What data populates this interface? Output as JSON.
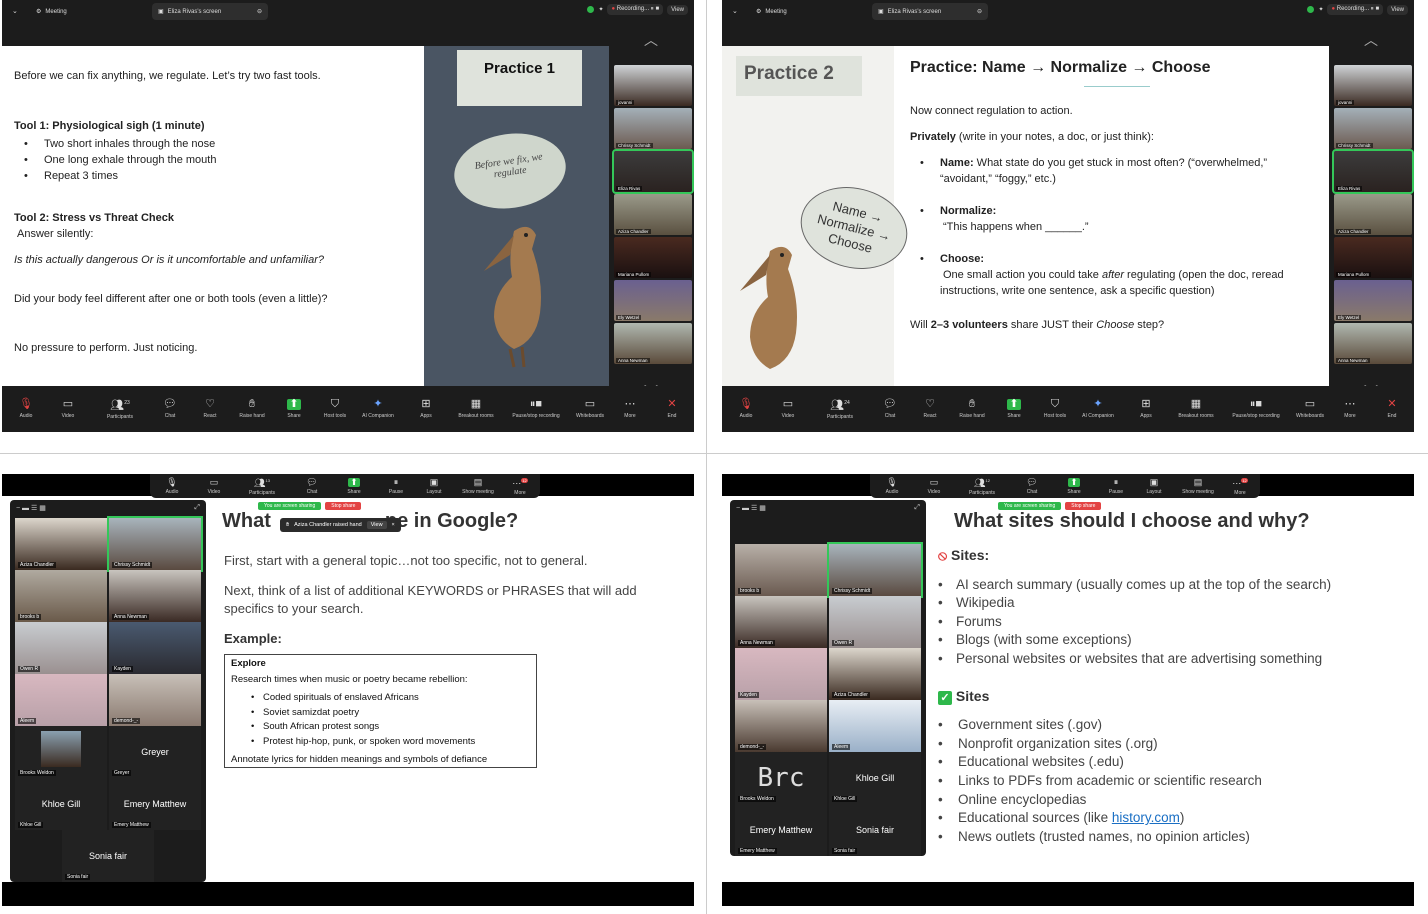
{
  "colors": {
    "zoom_green": "#2eb84b",
    "zoom_red": "#e34343",
    "link_blue": "#1a6fc4",
    "slide_gray": "#4a5563"
  },
  "zoom_top": {
    "meeting_tab": "Meeting",
    "screen_tab": "Eliza Rivas's screen",
    "recording": "Recording...",
    "view": "View"
  },
  "toolbar": [
    {
      "label": "Audio",
      "icon": "mic-muted-icon"
    },
    {
      "label": "Video",
      "icon": "video-icon"
    },
    {
      "label": "Participants",
      "icon": "participants-icon"
    },
    {
      "label": "Chat",
      "icon": "chat-icon"
    },
    {
      "label": "React",
      "icon": "react-icon"
    },
    {
      "label": "Raise hand",
      "icon": "raise-hand-icon"
    },
    {
      "label": "Share",
      "icon": "share-icon"
    },
    {
      "label": "Host tools",
      "icon": "shield-icon"
    },
    {
      "label": "AI Companion",
      "icon": "sparkle-icon"
    },
    {
      "label": "Apps",
      "icon": "apps-icon"
    },
    {
      "label": "Breakout rooms",
      "icon": "breakout-icon"
    },
    {
      "label": "Pause/stop recording",
      "icon": "pause-icon"
    },
    {
      "label": "Whiteboards",
      "icon": "whiteboard-icon"
    },
    {
      "label": "More",
      "icon": "more-icon"
    },
    {
      "label": "End",
      "icon": "end-icon"
    }
  ],
  "q1": {
    "participants_count": "23",
    "slide": {
      "intro": "Before we can fix anything, we regulate. Let’s try two fast tools.",
      "tool1_title": "Tool 1: Physiological sigh (1 minute)",
      "tool1_items": [
        "Two short inhales through the nose",
        "One long exhale through the mouth",
        "Repeat 3 times"
      ],
      "tool2_title": "Tool 2: Stress vs Threat Check",
      "tool2_sub": "Answer silently:",
      "question": "Is this actually dangerous Or is it uncomfortable and unfamiliar?",
      "did": "Did your body feel different after one or both tools (even a little)?",
      "no_pressure": "No pressure to perform. Just noticing.",
      "practice_title": "Practice 1",
      "bubble": "Before we fix, we regulate"
    },
    "thumbs": [
      "jovanni",
      "Chrissy Schmidt",
      "Eliza Rivas",
      "Aziza Chandler",
      "Mariana Pullom",
      "Ely Wetzel",
      "Anna Newman"
    ]
  },
  "q2": {
    "participants_count": "24",
    "slide": {
      "practice_title": "Practice 2",
      "bubble": "Name → Normalize → Choose",
      "heading": "Practice: Name → Normalize → Choose",
      "connect": "Now connect regulation to action.",
      "privately_bold": "Privately",
      "privately_rest": " (write in your notes, a doc, or just think):",
      "name_bold": "Name:",
      "name_rest": " What state do you get stuck in most often? (“overwhelmed,” “avoidant,” “foggy,” etc.)",
      "normalize_bold": "Normalize:",
      "normalize_rest": "“This happens when ______.”",
      "choose_bold": "Choose:",
      "choose_pre": "One small action you could take ",
      "choose_italic": "after",
      "choose_post": " regulating (open the doc, reread instructions, write one sentence, ask a specific question)",
      "will_pre": "Will ",
      "will_bold": "2–3 volunteers",
      "will_mid": " share JUST their ",
      "will_italic": "Choose",
      "will_post": " step?"
    },
    "thumbs": [
      "jovanni",
      "Chrissy Schmidt",
      "Eliza Rivas",
      "Aziza Chandler",
      "Mariana Pullom",
      "Ely Wetzel",
      "Anna Newman"
    ]
  },
  "share_toolbar": {
    "items": [
      "Audio",
      "Video",
      "Participants",
      "Chat",
      "Share",
      "Pause",
      "Layout",
      "Show meeting",
      "More"
    ],
    "sharing": "You are screen sharing",
    "stop": "Stop share"
  },
  "q3": {
    "participants_count": "13",
    "more_badge": "12",
    "raised_hand": "Aziza Chandler raised hand",
    "view": "View",
    "slide": {
      "heading_left": "What",
      "heading_right": "pe in Google?",
      "p1": "First, start with a general topic…not too specific, not to general.",
      "p2": "Next, think of a list of additional KEYWORDS or PHRASES that will add specifics to your search.",
      "example": "Example:",
      "box_title": "Explore",
      "box_intro": "Research times when music or poetry became rebellion:",
      "box_items": [
        "Coded spirituals of enslaved Africans",
        "Soviet samizdat poetry",
        "South African protest songs",
        "Protest hip-hop, punk, or spoken word movements"
      ],
      "box_foot": "Annotate lyrics for hidden meanings and symbols of defiance"
    },
    "tiles": [
      "Aziza Chandler",
      "Chrissy Schmidt",
      "brooks b",
      "Anna Newman",
      "Owen R",
      "Kayden",
      "Aleem",
      "demond-_-",
      "Brooks Weldon",
      "Greyer",
      "Khloe Gill",
      "Emery Matthew",
      "Sonia fair"
    ]
  },
  "q4": {
    "participants_count": "12",
    "more_badge": "12",
    "slide": {
      "heading": "What sites should I choose and why?",
      "no_label": "Sites:",
      "no_items": [
        "AI search summary (usually comes up at the top of the search)",
        "Wikipedia",
        "Forums",
        "Blogs (with some exceptions)",
        "Personal websites or websites that are advertising something"
      ],
      "yes_label": "Sites",
      "yes_items": [
        "Government sites (.gov)",
        "Nonprofit organization sites (.org)",
        "Educational websites (.edu)",
        "Links to PDFs from academic or scientific research",
        "Online encyclopedias"
      ],
      "edu_pre": "Educational sources (like ",
      "edu_link": "history.com",
      "edu_post": ")",
      "news": "News outlets (trusted names, no opinion articles)"
    },
    "tiles": [
      "brooks b",
      "Chrissy Schmidt",
      "Anna Newman",
      "Owen R",
      "Kayden",
      "Aziza Chandler",
      "demond-_-",
      "Aleem",
      "Brooks Weldon",
      "Khloe Gill",
      "Emery Matthew",
      "Sonia fair"
    ],
    "brc": "Brc"
  }
}
